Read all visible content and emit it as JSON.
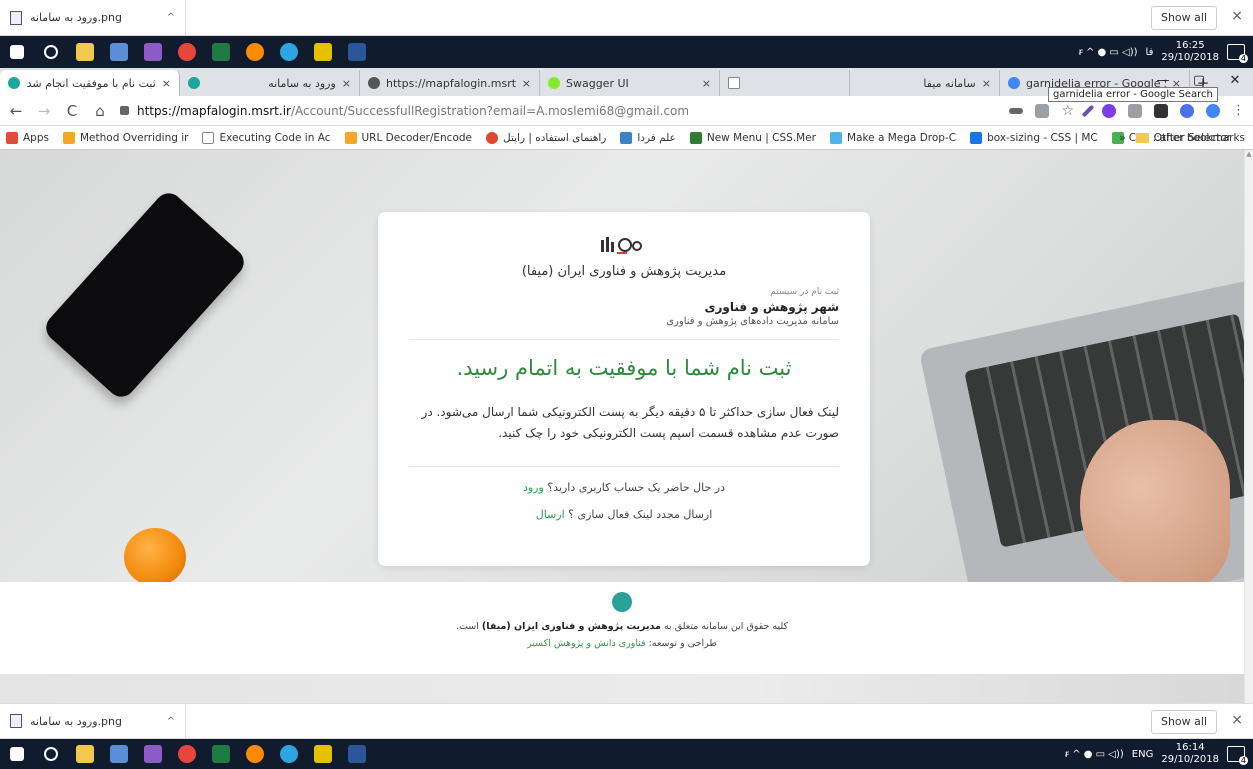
{
  "download_bar": {
    "file_name": "ورود به سامانه.png",
    "show_all": "Show all",
    "close": "×",
    "chevron": "^"
  },
  "taskbar": {
    "clock_top": {
      "time": "16:25",
      "date": "29/10/2018"
    },
    "clock_bottom": {
      "time": "16:14",
      "date": "29/10/2018"
    },
    "lang_top": "فا",
    "lang_bottom": "ENG",
    "notification_count": "4",
    "tray_glyphs": "ꞧ ^ ● ▭ ◁))"
  },
  "tabs": [
    {
      "title": "ثبت نام با موفقیت انجام شد",
      "favicon_color": "#1aa89b",
      "active": true
    },
    {
      "title": "ورود به سامانه",
      "favicon_color": "#1aa89b",
      "active": false
    },
    {
      "title": "https://mapfalogin.msrt.ir/Acc",
      "favicon_color": "#555555",
      "active": false
    },
    {
      "title": "Swagger UI",
      "favicon_color": "#85ea2d",
      "active": false
    },
    {
      "title": "",
      "favicon_color": "#dddddd",
      "active": false
    },
    {
      "title": "سامانه میفا",
      "favicon_color": "#dddddd",
      "active": false
    },
    {
      "title": "garnidelia error - Google Sear",
      "favicon_color": "#4285f4",
      "active": false
    }
  ],
  "tab_close": "×",
  "new_tab": "+",
  "window_controls": {
    "minimize": "—",
    "maximize": "▢",
    "close": "✕"
  },
  "tooltip": "garnidelia error - Google Search",
  "address_bar": {
    "back": "←",
    "forward": "→",
    "reload": "C",
    "home": "⌂",
    "url_host": "https://mapfalogin.msrt.ir",
    "url_rest": "/Account/SuccessfullRegistration?email=A.moslemi68@gmail.com",
    "star": "☆",
    "menu": "⋮"
  },
  "bookmarks": {
    "items": [
      {
        "label": "Apps",
        "color": "#e04b3a"
      },
      {
        "label": "Method Overriding ir",
        "color": "#f5a623"
      },
      {
        "label": "Executing Code in Ac",
        "color": "#ffffff"
      },
      {
        "label": "URL Decoder/Encode",
        "color": "#f5a623"
      },
      {
        "label": "راهنمای استفاده | راپتل",
        "color": "#e0452d"
      },
      {
        "label": "علم فردا",
        "color": "#3b82c4"
      },
      {
        "label": "New Menu | CSS.Mer",
        "color": "#2e7d32"
      },
      {
        "label": "Make a Mega Drop-C",
        "color": "#4fb3e8"
      },
      {
        "label": "box-sizing - CSS | MC",
        "color": "#1a73e8"
      },
      {
        "label": "CSS ::after Selector",
        "color": "#4caf50"
      }
    ],
    "more": "»",
    "other": "Other bookmarks"
  },
  "card": {
    "org_name": "مدیریت پژوهش و فناوری ایران (میفا)",
    "sys_sub": "ثبت نام در سیستم",
    "sys_name": "شهر پژوهش و فناوری",
    "sys_desc": "سامانه مدیریت داده‌های پژوهش و فناوری",
    "success_title": "ثبت نام شما با موفقیت به اتمام رسید.",
    "message": "لینک فعال سازی حداکثر تا ۵ دقیقه دیگر به پست الکترونیکی شما ارسال می‌شود. در صورت عدم مشاهده قسمت اسپم پست الکترونیکی خود را چک کنید.",
    "have_account": "در حال حاضر یک حساب کاربری دارید؟",
    "login_link": "ورود",
    "resend_text": "ارسال مجدد لینک فعال سازی ؟",
    "resend_link": "ارسال"
  },
  "footer": {
    "rights_prefix": "کلیه حقوق این سامانه متعلق به",
    "rights_org": "مدیریت پژوهش و فناوری ایران (میفا)",
    "rights_suffix": "است.",
    "dev_prefix": "طراحی و توسعه:",
    "dev_link": "فناوری دانش و پژوهش اکسیر"
  },
  "colors": {
    "accent_green": "#2e8b3d",
    "link_green": "#2e9a48",
    "taskbar": "#101b2e",
    "tabstrip": "#dee1e6"
  }
}
